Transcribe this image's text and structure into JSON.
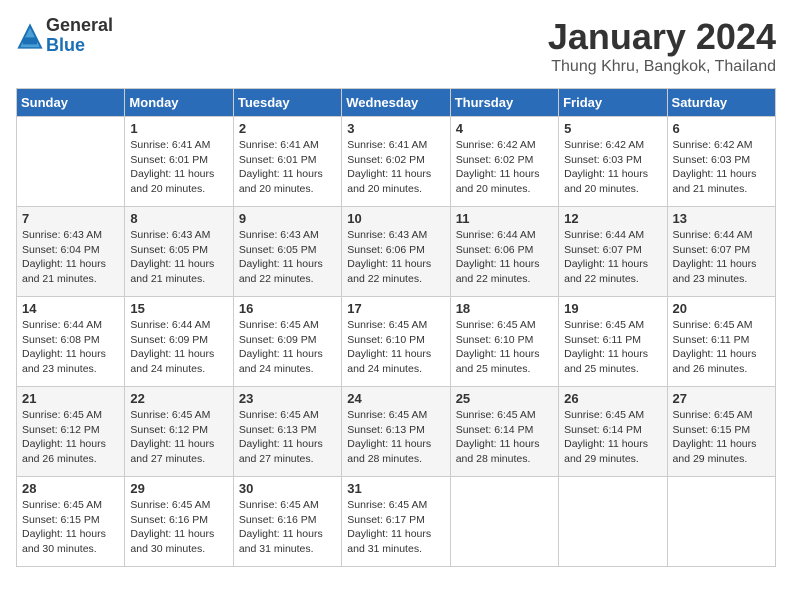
{
  "logo": {
    "general": "General",
    "blue": "Blue"
  },
  "title": "January 2024",
  "location": "Thung Khru, Bangkok, Thailand",
  "days_of_week": [
    "Sunday",
    "Monday",
    "Tuesday",
    "Wednesday",
    "Thursday",
    "Friday",
    "Saturday"
  ],
  "weeks": [
    [
      {
        "day": "",
        "sunrise": "",
        "sunset": "",
        "daylight": ""
      },
      {
        "day": "1",
        "sunrise": "Sunrise: 6:41 AM",
        "sunset": "Sunset: 6:01 PM",
        "daylight": "Daylight: 11 hours and 20 minutes."
      },
      {
        "day": "2",
        "sunrise": "Sunrise: 6:41 AM",
        "sunset": "Sunset: 6:01 PM",
        "daylight": "Daylight: 11 hours and 20 minutes."
      },
      {
        "day": "3",
        "sunrise": "Sunrise: 6:41 AM",
        "sunset": "Sunset: 6:02 PM",
        "daylight": "Daylight: 11 hours and 20 minutes."
      },
      {
        "day": "4",
        "sunrise": "Sunrise: 6:42 AM",
        "sunset": "Sunset: 6:02 PM",
        "daylight": "Daylight: 11 hours and 20 minutes."
      },
      {
        "day": "5",
        "sunrise": "Sunrise: 6:42 AM",
        "sunset": "Sunset: 6:03 PM",
        "daylight": "Daylight: 11 hours and 20 minutes."
      },
      {
        "day": "6",
        "sunrise": "Sunrise: 6:42 AM",
        "sunset": "Sunset: 6:03 PM",
        "daylight": "Daylight: 11 hours and 21 minutes."
      }
    ],
    [
      {
        "day": "7",
        "sunrise": "Sunrise: 6:43 AM",
        "sunset": "Sunset: 6:04 PM",
        "daylight": "Daylight: 11 hours and 21 minutes."
      },
      {
        "day": "8",
        "sunrise": "Sunrise: 6:43 AM",
        "sunset": "Sunset: 6:05 PM",
        "daylight": "Daylight: 11 hours and 21 minutes."
      },
      {
        "day": "9",
        "sunrise": "Sunrise: 6:43 AM",
        "sunset": "Sunset: 6:05 PM",
        "daylight": "Daylight: 11 hours and 22 minutes."
      },
      {
        "day": "10",
        "sunrise": "Sunrise: 6:43 AM",
        "sunset": "Sunset: 6:06 PM",
        "daylight": "Daylight: 11 hours and 22 minutes."
      },
      {
        "day": "11",
        "sunrise": "Sunrise: 6:44 AM",
        "sunset": "Sunset: 6:06 PM",
        "daylight": "Daylight: 11 hours and 22 minutes."
      },
      {
        "day": "12",
        "sunrise": "Sunrise: 6:44 AM",
        "sunset": "Sunset: 6:07 PM",
        "daylight": "Daylight: 11 hours and 22 minutes."
      },
      {
        "day": "13",
        "sunrise": "Sunrise: 6:44 AM",
        "sunset": "Sunset: 6:07 PM",
        "daylight": "Daylight: 11 hours and 23 minutes."
      }
    ],
    [
      {
        "day": "14",
        "sunrise": "Sunrise: 6:44 AM",
        "sunset": "Sunset: 6:08 PM",
        "daylight": "Daylight: 11 hours and 23 minutes."
      },
      {
        "day": "15",
        "sunrise": "Sunrise: 6:44 AM",
        "sunset": "Sunset: 6:09 PM",
        "daylight": "Daylight: 11 hours and 24 minutes."
      },
      {
        "day": "16",
        "sunrise": "Sunrise: 6:45 AM",
        "sunset": "Sunset: 6:09 PM",
        "daylight": "Daylight: 11 hours and 24 minutes."
      },
      {
        "day": "17",
        "sunrise": "Sunrise: 6:45 AM",
        "sunset": "Sunset: 6:10 PM",
        "daylight": "Daylight: 11 hours and 24 minutes."
      },
      {
        "day": "18",
        "sunrise": "Sunrise: 6:45 AM",
        "sunset": "Sunset: 6:10 PM",
        "daylight": "Daylight: 11 hours and 25 minutes."
      },
      {
        "day": "19",
        "sunrise": "Sunrise: 6:45 AM",
        "sunset": "Sunset: 6:11 PM",
        "daylight": "Daylight: 11 hours and 25 minutes."
      },
      {
        "day": "20",
        "sunrise": "Sunrise: 6:45 AM",
        "sunset": "Sunset: 6:11 PM",
        "daylight": "Daylight: 11 hours and 26 minutes."
      }
    ],
    [
      {
        "day": "21",
        "sunrise": "Sunrise: 6:45 AM",
        "sunset": "Sunset: 6:12 PM",
        "daylight": "Daylight: 11 hours and 26 minutes."
      },
      {
        "day": "22",
        "sunrise": "Sunrise: 6:45 AM",
        "sunset": "Sunset: 6:12 PM",
        "daylight": "Daylight: 11 hours and 27 minutes."
      },
      {
        "day": "23",
        "sunrise": "Sunrise: 6:45 AM",
        "sunset": "Sunset: 6:13 PM",
        "daylight": "Daylight: 11 hours and 27 minutes."
      },
      {
        "day": "24",
        "sunrise": "Sunrise: 6:45 AM",
        "sunset": "Sunset: 6:13 PM",
        "daylight": "Daylight: 11 hours and 28 minutes."
      },
      {
        "day": "25",
        "sunrise": "Sunrise: 6:45 AM",
        "sunset": "Sunset: 6:14 PM",
        "daylight": "Daylight: 11 hours and 28 minutes."
      },
      {
        "day": "26",
        "sunrise": "Sunrise: 6:45 AM",
        "sunset": "Sunset: 6:14 PM",
        "daylight": "Daylight: 11 hours and 29 minutes."
      },
      {
        "day": "27",
        "sunrise": "Sunrise: 6:45 AM",
        "sunset": "Sunset: 6:15 PM",
        "daylight": "Daylight: 11 hours and 29 minutes."
      }
    ],
    [
      {
        "day": "28",
        "sunrise": "Sunrise: 6:45 AM",
        "sunset": "Sunset: 6:15 PM",
        "daylight": "Daylight: 11 hours and 30 minutes."
      },
      {
        "day": "29",
        "sunrise": "Sunrise: 6:45 AM",
        "sunset": "Sunset: 6:16 PM",
        "daylight": "Daylight: 11 hours and 30 minutes."
      },
      {
        "day": "30",
        "sunrise": "Sunrise: 6:45 AM",
        "sunset": "Sunset: 6:16 PM",
        "daylight": "Daylight: 11 hours and 31 minutes."
      },
      {
        "day": "31",
        "sunrise": "Sunrise: 6:45 AM",
        "sunset": "Sunset: 6:17 PM",
        "daylight": "Daylight: 11 hours and 31 minutes."
      },
      {
        "day": "",
        "sunrise": "",
        "sunset": "",
        "daylight": ""
      },
      {
        "day": "",
        "sunrise": "",
        "sunset": "",
        "daylight": ""
      },
      {
        "day": "",
        "sunrise": "",
        "sunset": "",
        "daylight": ""
      }
    ]
  ]
}
